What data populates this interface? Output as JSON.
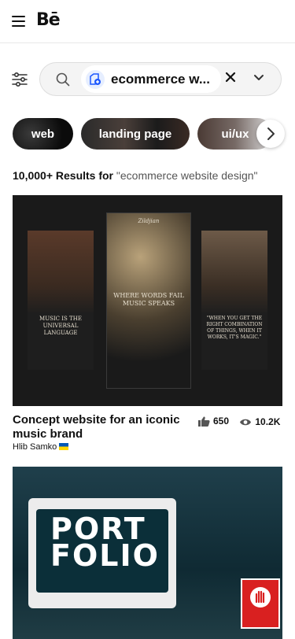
{
  "app": {
    "logo_text": "Bē"
  },
  "search": {
    "value": "ecommerce w...",
    "icons": {
      "search": "search-icon",
      "filter": "sliders-icon",
      "clear": "close-icon",
      "expand": "chevron-down-icon"
    }
  },
  "chips": [
    {
      "label": "web"
    },
    {
      "label": "landing page"
    },
    {
      "label": "ui/ux"
    }
  ],
  "results": {
    "count": "10,000+ Results for",
    "query": "\"ecommerce website design\""
  },
  "projects": [
    {
      "title": "Concept website for an iconic music brand",
      "author": "Hlib Samko",
      "likes": "650",
      "views": "10.2K",
      "thumb_texts": {
        "left_quote": "MUSIC IS THE UNIVERSAL LANGUAGE",
        "center_quote": "WHERE WORDS FAIL MUSIC SPEAKS",
        "right_quote": "\"WHEN YOU GET THE RIGHT COMBINATION OF THINGS, WHEN IT WORKS, IT'S MAGIC.\"",
        "brand": "Zildjian"
      }
    },
    {
      "title": "",
      "thumb_texts": {
        "word_top": "PORT",
        "word_bottom": "FOLIO"
      }
    }
  ],
  "colors": {
    "accent": "#0057ff",
    "text": "#111111",
    "muted": "#555555"
  }
}
